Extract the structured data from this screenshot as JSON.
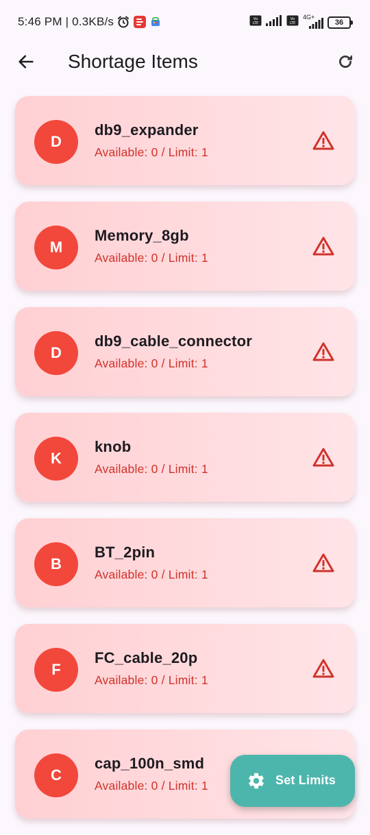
{
  "status_bar": {
    "time_speed": "5:46 PM | 0.3KB/s",
    "battery": "36",
    "network_label": "4G+"
  },
  "app_bar": {
    "title": "Shortage Items"
  },
  "items": [
    {
      "initial": "D",
      "name": "db9_expander",
      "status": "Available: 0 / Limit: 1"
    },
    {
      "initial": "M",
      "name": "Memory_8gb",
      "status": "Available: 0 / Limit: 1"
    },
    {
      "initial": "D",
      "name": "db9_cable_connector",
      "status": "Available: 0 / Limit: 1"
    },
    {
      "initial": "K",
      "name": "knob",
      "status": "Available: 0 / Limit: 1"
    },
    {
      "initial": "B",
      "name": "BT_2pin",
      "status": "Available: 0 / Limit: 1"
    },
    {
      "initial": "F",
      "name": "FC_cable_20p",
      "status": "Available: 0 / Limit: 1"
    },
    {
      "initial": "C",
      "name": "cap_100n_smd",
      "status": "Available: 0 / Limit: 1"
    }
  ],
  "fab": {
    "label": "Set Limits",
    "icon": "gear-icon"
  },
  "colors": {
    "avatar": "#f2473b",
    "warning": "#d0322a",
    "fab": "#4db6ac",
    "card_start": "#ffd0d3",
    "card_end": "#ffe4e7"
  }
}
